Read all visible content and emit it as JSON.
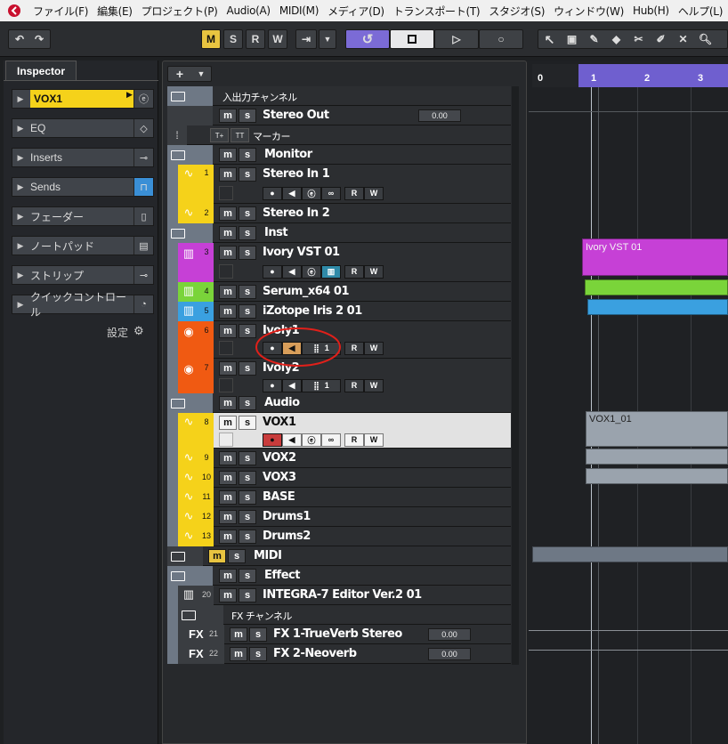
{
  "menu": [
    "ファイル(F)",
    "編集(E)",
    "プロジェクト(P)",
    "Audio(A)",
    "MIDI(M)",
    "メディア(D)",
    "トランスポート(T)",
    "スタジオ(S)",
    "ウィンドウ(W)",
    "Hub(H)",
    "ヘルプ(L)"
  ],
  "toolbar": {
    "m": "M",
    "s": "S",
    "r": "R",
    "w": "W"
  },
  "inspector": {
    "tab": "Inspector",
    "track_name": "VOX1",
    "sections": [
      "EQ",
      "Inserts",
      "Sends",
      "フェーダー",
      "ノートパッド",
      "ストリップ",
      "クイックコントロール"
    ],
    "settings": "設定"
  },
  "tracks": {
    "io_folder": "入出力チャンネル",
    "stereo_out": "Stereo Out",
    "stereo_out_vol": "0.00",
    "marker": "マーカー",
    "monitor": "Monitor",
    "stereo_in1": "Stereo In 1",
    "n1": "1",
    "stereo_in2": "Stereo In 2",
    "n2": "2",
    "inst": "Inst",
    "ivory": "Ivory VST 01",
    "n3": "3",
    "serum": "Serum_x64 01",
    "n4": "4",
    "izotope": "iZotope Iris 2 01",
    "n5": "5",
    "ivoly1": "Ivoly1",
    "n6": "6",
    "ivoly1_ch": "1",
    "ivoly2": "Ivoly2",
    "n7": "7",
    "ivoly2_ch": "1",
    "audio": "Audio",
    "vox1": "VOX1",
    "n8": "8",
    "vox2": "VOX2",
    "n9": "9",
    "vox3": "VOX3",
    "n10": "10",
    "base": "BASE",
    "n11": "11",
    "drums1": "Drums1",
    "n12": "12",
    "drums2": "Drums2",
    "n13": "13",
    "midi": "MIDI",
    "effect": "Effect",
    "integra": "INTEGRA-7 Editor Ver.2 01",
    "n20": "20",
    "fx_folder": "FX チャンネル",
    "fx1": "FX 1-TrueVerb Stereo",
    "n21": "21",
    "fx1_vol": "0.00",
    "fx2": "FX 2-Neoverb",
    "n22": "22",
    "fx2_vol": "0.00",
    "fx_label": "FX",
    "rw_r": "R",
    "rw_w": "W"
  },
  "ruler": [
    "0",
    "1",
    "2",
    "3"
  ],
  "clips": {
    "ivory": "Ivory VST 01",
    "vox1": "VOX1_01"
  },
  "colors": {
    "yellow": "#f5d21a",
    "magenta": "#c640d6",
    "green": "#7ad43a",
    "blue": "#3aa0e0",
    "orange": "#f05a12",
    "folder": "#6e7885",
    "accent": "#7b6bd6"
  }
}
